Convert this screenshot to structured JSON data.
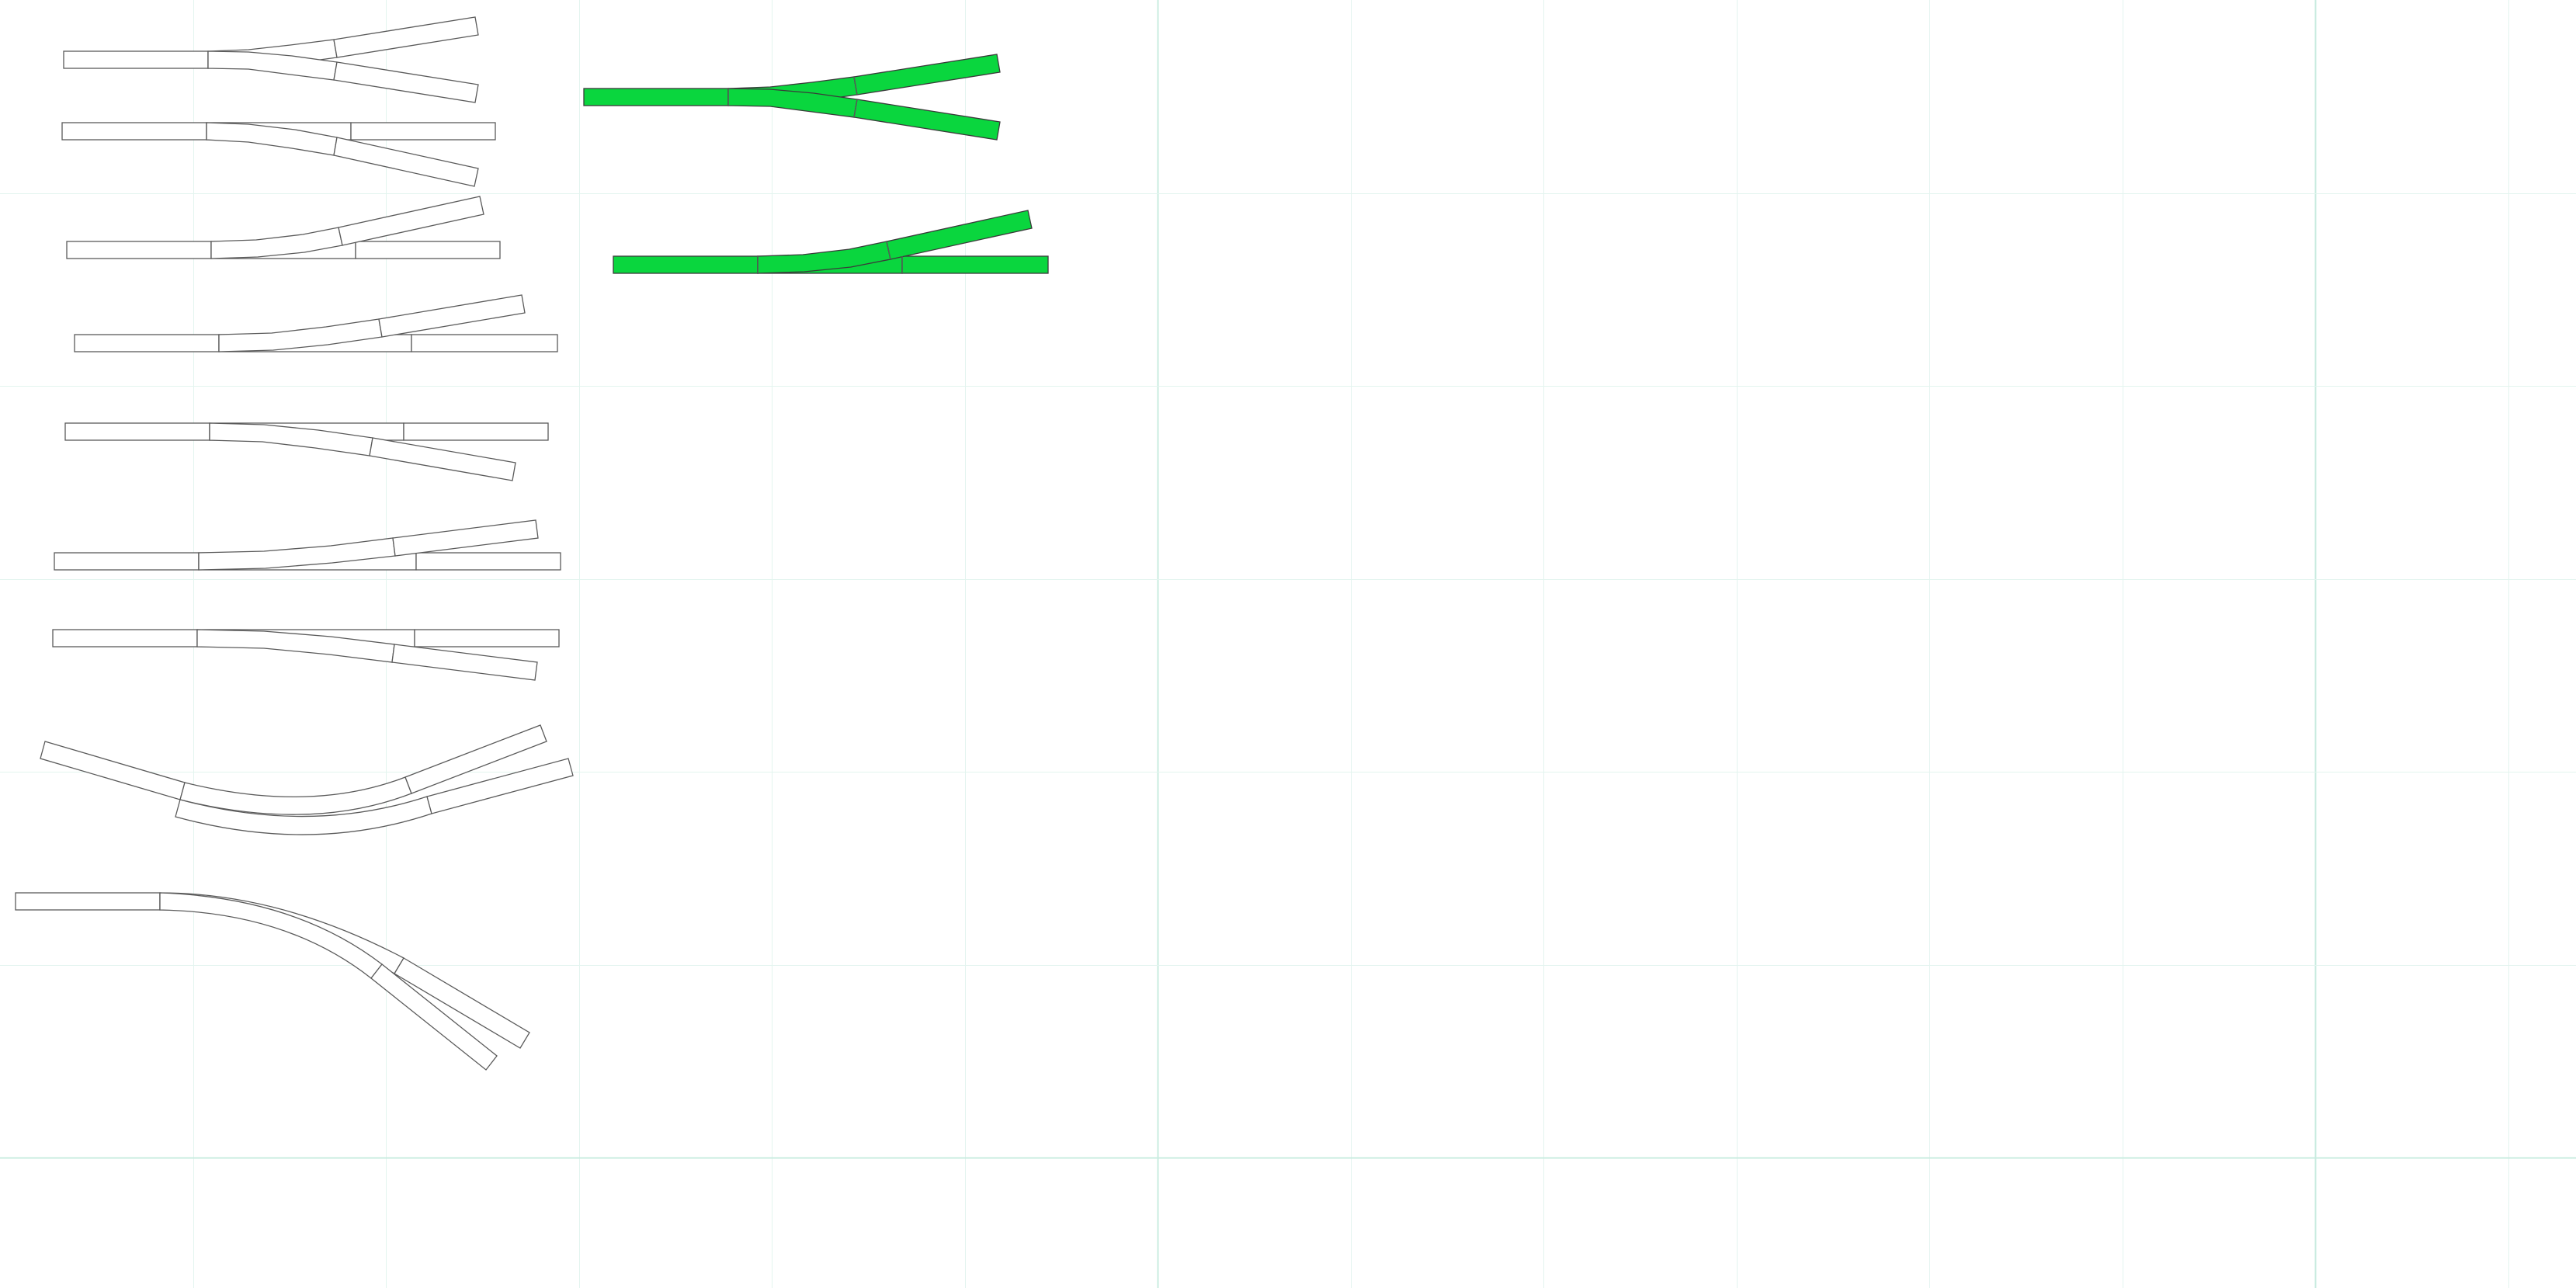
{
  "workspace": {
    "background": "#ffffff",
    "grid_color": "#e3f4ef",
    "grid_major_color": "#c9ece0"
  },
  "palette": {
    "title": "",
    "pieces": [
      {
        "name": "symmetric-wye-switch",
        "icon": "wye-turnout-icon"
      },
      {
        "name": "left-switch-short",
        "icon": "left-turnout-icon"
      },
      {
        "name": "right-switch",
        "icon": "right-turnout-icon"
      },
      {
        "name": "right-switch-long",
        "icon": "right-turnout-icon"
      },
      {
        "name": "left-switch",
        "icon": "left-turnout-icon"
      },
      {
        "name": "right-switch-slim",
        "icon": "right-turnout-icon"
      },
      {
        "name": "left-switch-slim",
        "icon": "left-turnout-icon"
      },
      {
        "name": "curved-switch",
        "icon": "curved-turnout-icon"
      },
      {
        "name": "curved-switch-large",
        "icon": "curved-turnout-icon"
      }
    ]
  },
  "layout": {
    "placed_color": "#0ad63e",
    "placed_pieces": [
      {
        "name": "placed-wye-switch",
        "icon": "wye-turnout-icon"
      },
      {
        "name": "placed-right-switch",
        "icon": "right-turnout-icon"
      }
    ]
  }
}
